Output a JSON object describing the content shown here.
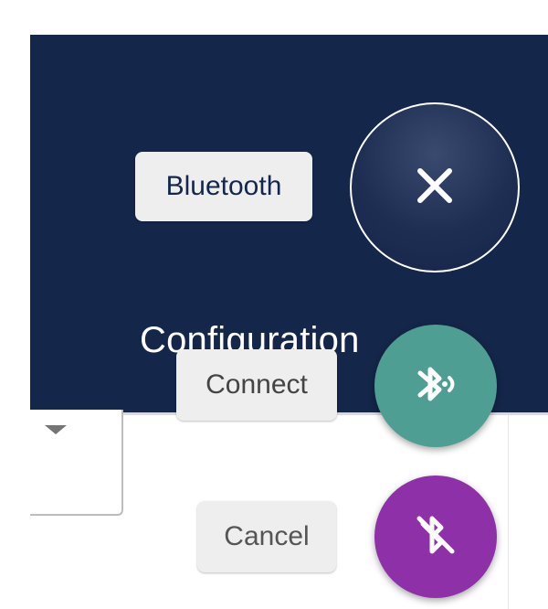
{
  "page": {
    "title": "Configuration"
  },
  "speed_dial": {
    "main_button": {
      "icon": "close-icon",
      "color": "#1e2d52"
    },
    "actions": [
      {
        "label": "Bluetooth",
        "icon": "close-icon"
      },
      {
        "label": "Connect",
        "icon": "bluetooth-connect-icon",
        "color": "#4f9e93"
      },
      {
        "label": "Cancel",
        "icon": "bluetooth-disabled-icon",
        "color": "#8e30a8"
      }
    ]
  },
  "colors": {
    "header_background": "#14264a",
    "connect_fab": "#4f9e93",
    "cancel_fab": "#8e30a8"
  }
}
